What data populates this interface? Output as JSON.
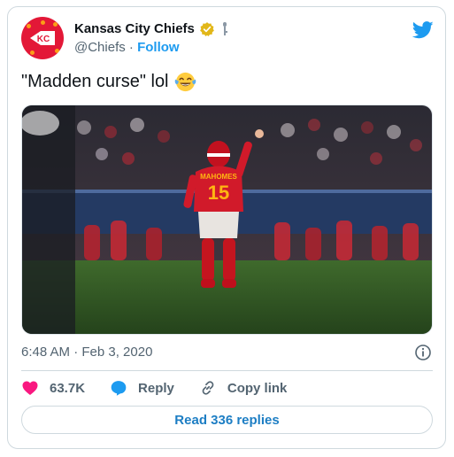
{
  "author": {
    "name": "Kansas City Chiefs",
    "handle": "@Chiefs",
    "separator": "·",
    "follow_label": "Follow",
    "avatar_icon": "chiefs-arrowhead-logo",
    "avatar_color": "#e31837",
    "verified_icon": "verified-gold-badge",
    "verified_color": "#e2b719"
  },
  "tweet": {
    "text": "\"Madden curse\" lol",
    "emoji": "face-with-tears-of-joy",
    "photo_alt": "photo",
    "jersey_name": "MAHOMES",
    "jersey_number": "15",
    "timestamp": "6:48 AM · Feb 3, 2020"
  },
  "actions": {
    "like_count": "63.7K",
    "reply_label": "Reply",
    "copy_link_label": "Copy link"
  },
  "footer": {
    "read_replies_label": "Read 336 replies"
  },
  "colors": {
    "twitter_blue": "#1d9bf0",
    "like_pink": "#f91880",
    "text_secondary": "#536471",
    "border": "#cfd9de"
  }
}
